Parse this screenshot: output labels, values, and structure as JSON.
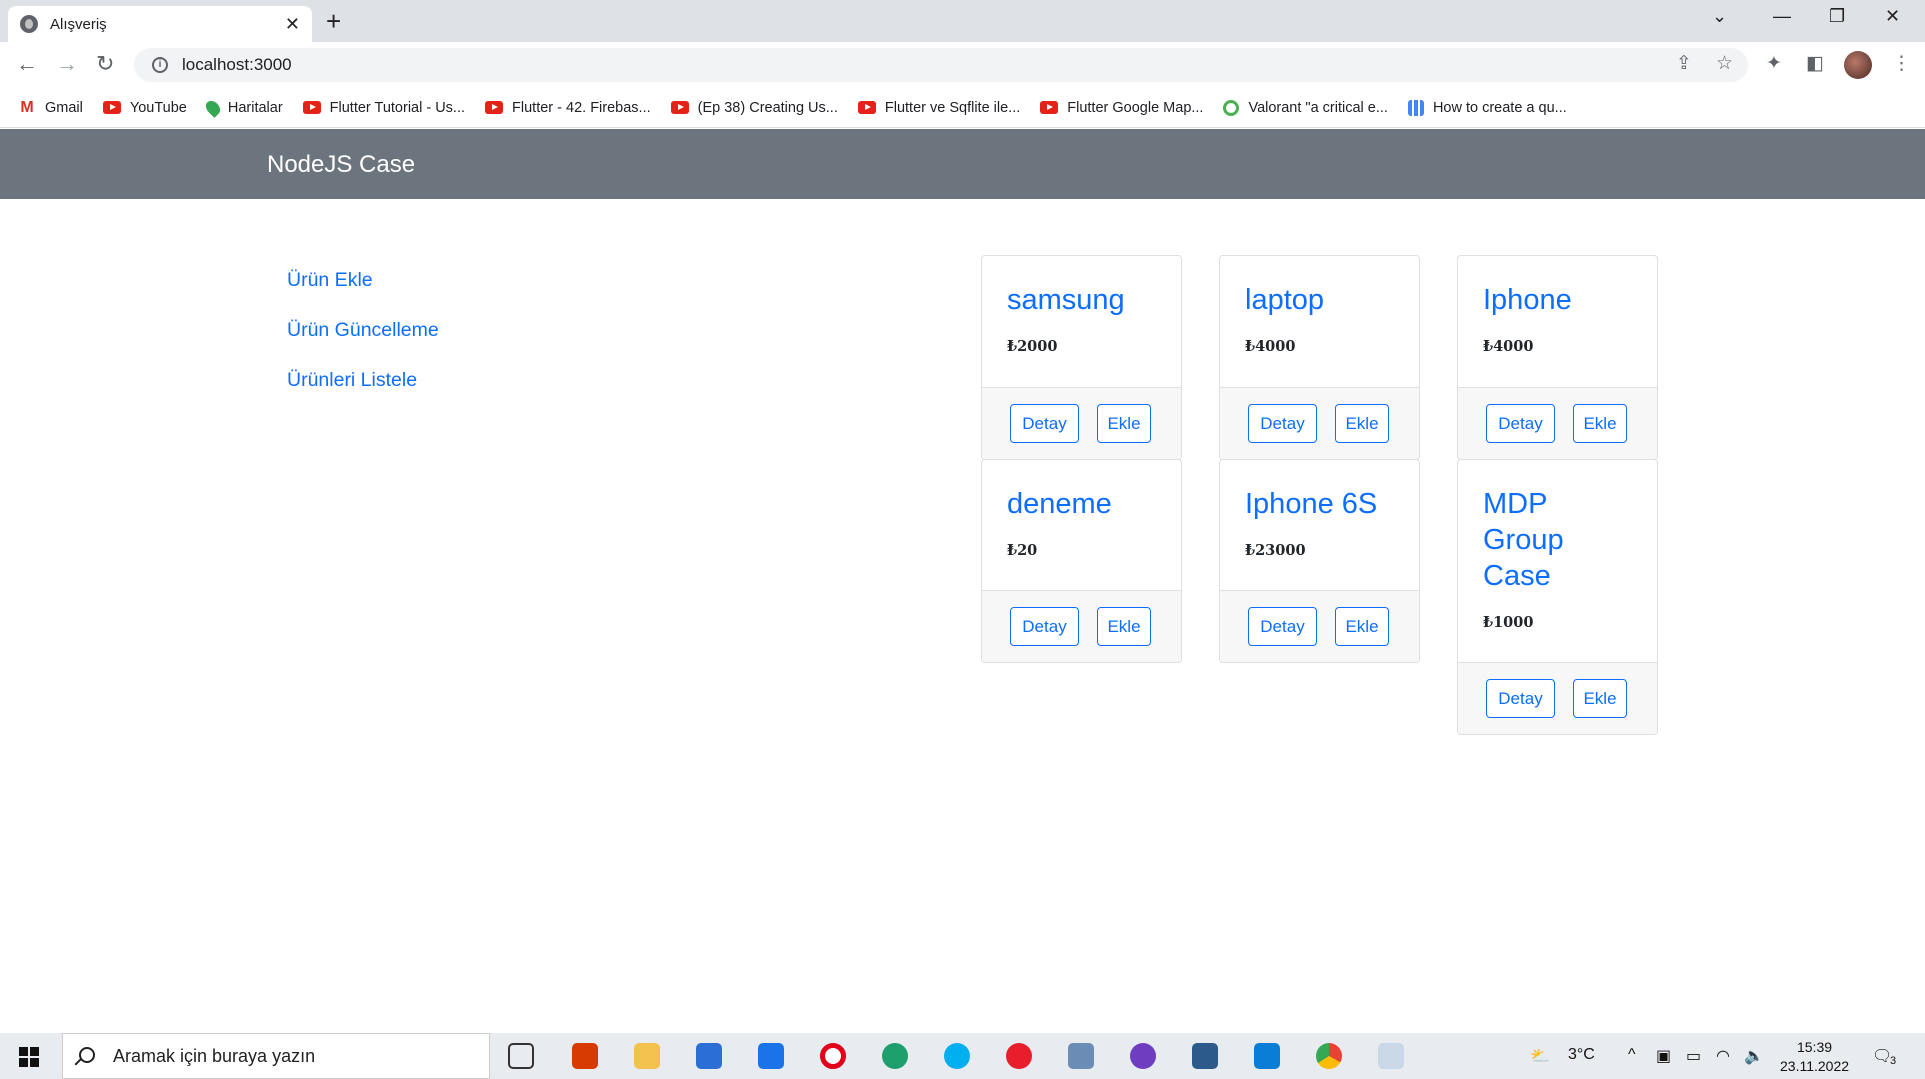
{
  "browser": {
    "tab_title": "Alışveriş",
    "tab_close": "✕",
    "new_tab": "+",
    "url": "localhost:3000",
    "bookmarks": [
      {
        "label": "Gmail",
        "icon": "gmail-icon"
      },
      {
        "label": "YouTube",
        "icon": "youtube-icon"
      },
      {
        "label": "Haritalar",
        "icon": "maps-icon"
      },
      {
        "label": "Flutter Tutorial - Us...",
        "icon": "youtube-icon"
      },
      {
        "label": "Flutter - 42. Firebas...",
        "icon": "youtube-icon"
      },
      {
        "label": "(Ep 38) Creating Us...",
        "icon": "youtube-icon"
      },
      {
        "label": "Flutter ve Sqflite ile...",
        "icon": "youtube-icon"
      },
      {
        "label": "Flutter Google Map...",
        "icon": "youtube-icon"
      },
      {
        "label": "Valorant \"a critical e...",
        "icon": "power-icon"
      },
      {
        "label": "How to create a qu...",
        "icon": "grid-icon"
      }
    ]
  },
  "app": {
    "brand": "NodeJS Case",
    "sidebar": [
      {
        "label": "Ürün Ekle"
      },
      {
        "label": "Ürün Güncelleme"
      },
      {
        "label": "Ürünleri Listele"
      }
    ],
    "products": [
      {
        "name": "samsung",
        "price": "₺2000",
        "detail": "Detay",
        "add": "Ekle"
      },
      {
        "name": "laptop",
        "price": "₺4000",
        "detail": "Detay",
        "add": "Ekle"
      },
      {
        "name": "Iphone",
        "price": "₺4000",
        "detail": "Detay",
        "add": "Ekle"
      },
      {
        "name": "deneme",
        "price": "₺20",
        "detail": "Detay",
        "add": "Ekle"
      },
      {
        "name": "Iphone 6S",
        "price": "₺23000",
        "detail": "Detay",
        "add": "Ekle"
      },
      {
        "name": "MDP Group Case",
        "price": "₺1000",
        "detail": "Detay",
        "add": "Ekle"
      }
    ],
    "colors": {
      "navbar": "#6c757d",
      "link": "#0d6efd"
    }
  },
  "taskbar": {
    "search_placeholder": "Aramak için buraya yazın",
    "weather": "3°C",
    "time": "15:39",
    "date": "23.11.2022",
    "notifications": "3"
  }
}
